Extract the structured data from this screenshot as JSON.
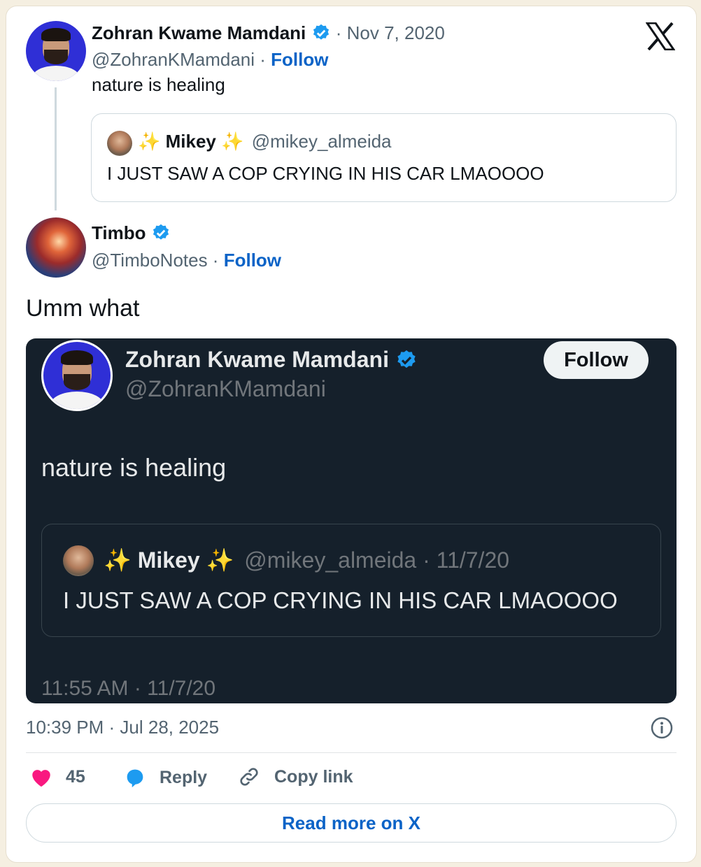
{
  "outer_tweet": {
    "author_name": "Zohran Kwame Mamdani",
    "date": "· Nov 7, 2020",
    "handle": "@ZohranKMamdani ·",
    "follow": "Follow",
    "text": "nature is healing",
    "quote": {
      "sparkle_left": "✨",
      "name": "Mikey",
      "sparkle_right": "✨",
      "handle": "@mikey_almeida",
      "text": "I JUST SAW A COP CRYING IN HIS CAR LMAOOOO"
    }
  },
  "reply_tweet": {
    "author_name": "Timbo",
    "handle": "@TimboNotes ·",
    "follow": "Follow",
    "text": "Umm what",
    "embed": {
      "author_name": "Zohran Kwame Mamdani",
      "handle": "@ZohranKMamdani",
      "follow": "Follow",
      "text": "nature is healing",
      "quote": {
        "sparkle_left": "✨",
        "name": "Mikey",
        "sparkle_right": "✨",
        "handle": "@mikey_almeida",
        "dot_date": "· 11/7/20",
        "text": "I JUST SAW A COP CRYING IN HIS CAR LMAOOOO"
      },
      "timestamp": "11:55 AM · 11/7/20"
    },
    "timestamp": "10:39 PM · Jul 28, 2025",
    "likes": "45",
    "reply_label": "Reply",
    "copy_label": "Copy link",
    "read_more": "Read more on X"
  },
  "colors": {
    "page_bg": "#f5efe1",
    "link_blue": "#0b63c7",
    "verified_blue": "#1d9bf0",
    "dark_bg": "#15202b",
    "heart": "#f91880"
  },
  "icons": [
    "x-logo-icon",
    "verified-icon",
    "heart-icon",
    "reply-icon",
    "link-icon",
    "info-icon"
  ]
}
